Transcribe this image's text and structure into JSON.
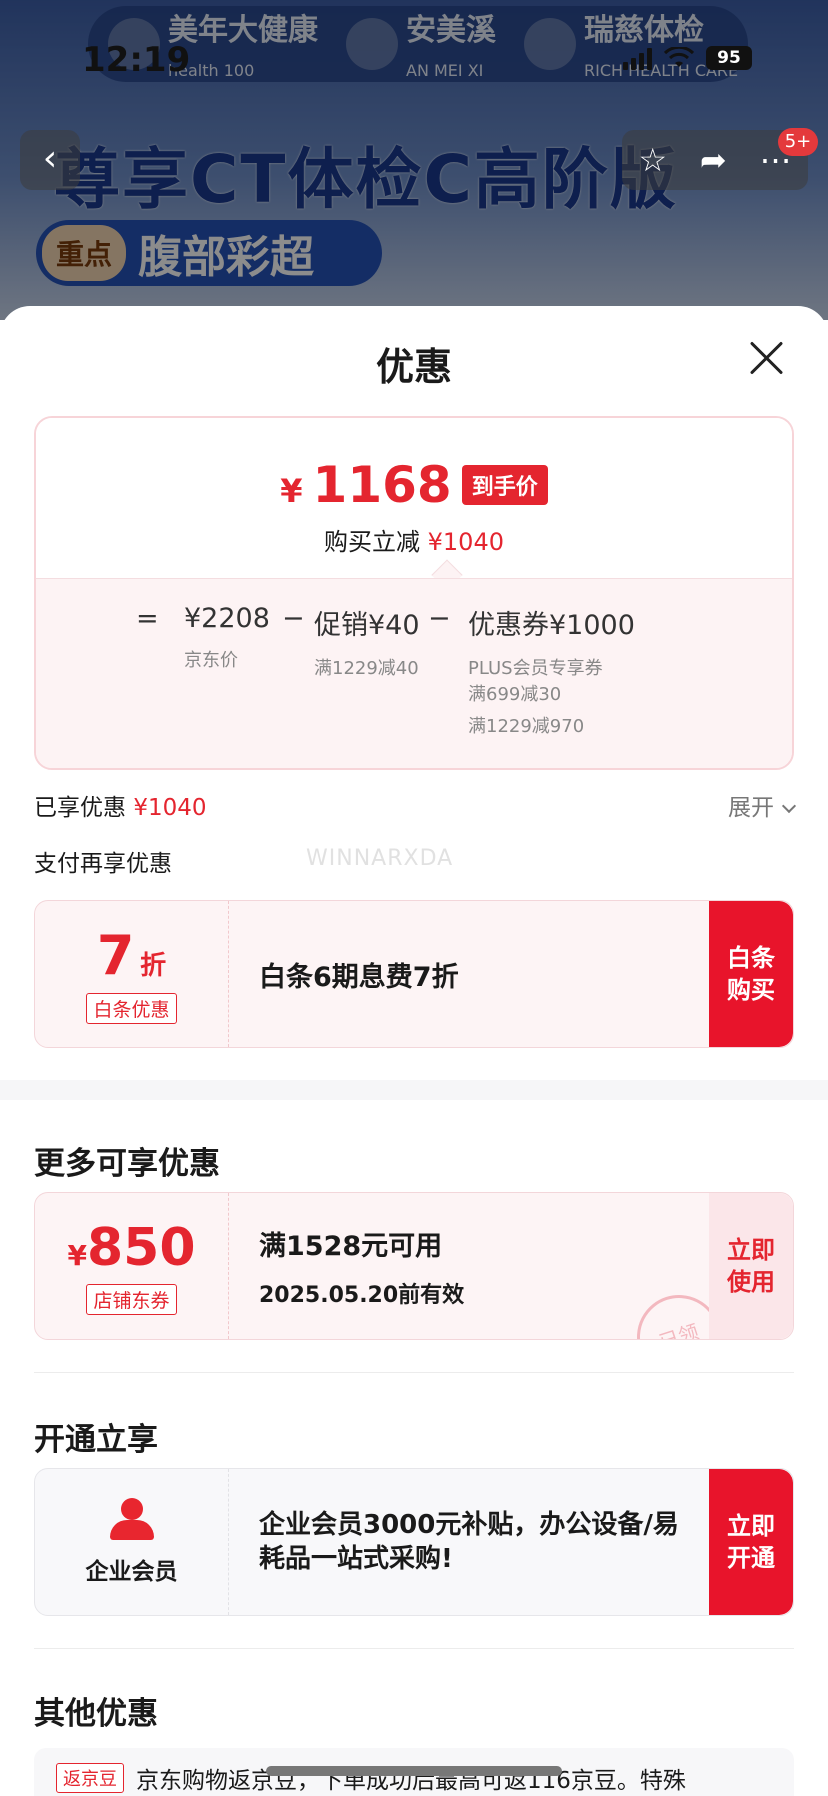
{
  "status_bar": {
    "time": "12:19",
    "battery": "95"
  },
  "background": {
    "brands": [
      {
        "name": "美年大健康",
        "sub": "health 100"
      },
      {
        "name": "安美溪",
        "sub": "AN MEI XI"
      },
      {
        "name": "瑞慈体检",
        "sub": "RICH HEALTH CARE"
      }
    ],
    "title": "尊享CT体检C高阶版",
    "pill_tag": "重点",
    "pill_text": "腹部彩超",
    "cart_badge": "5+"
  },
  "sheet": {
    "title": "优惠",
    "final_price": {
      "yen": "¥",
      "amount": "1168",
      "tag": "到手价"
    },
    "instant_reduce": {
      "label": "购买立减",
      "amount": "¥1040"
    },
    "breakdown": {
      "eq": "=",
      "minus": "−",
      "jd_price": {
        "value": "¥2208",
        "label": "京东价"
      },
      "promo": {
        "value": "促销¥40",
        "label": "满1229减40"
      },
      "coupon": {
        "value": "优惠券¥1000",
        "label1": "PLUS会员专享券",
        "label2": "满699减30",
        "label3": "满1229减970"
      }
    },
    "enjoyed": {
      "label": "已享优惠",
      "amount": "¥1040",
      "expand": "展开"
    },
    "pay_more_title": "支付再享优惠",
    "watermark": "WINNARXDA",
    "baitiao": {
      "num": "7",
      "unit": "折",
      "tag": "白条优惠",
      "desc": "白条6期息费7折",
      "cta": "白条购买"
    },
    "more_title": "更多可享优惠",
    "shop_coupon": {
      "yen": "¥",
      "amount": "850",
      "tag": "店铺东券",
      "line1": "满1528元可用",
      "line2": "2025.05.20前有效",
      "stamp": "已领",
      "cta": "立即使用"
    },
    "open_title": "开通立享",
    "enterprise": {
      "label": "企业会员",
      "desc": "企业会员3000元补贴，办公设备/易耗品一站式采购!",
      "cta": "立即开通"
    },
    "other_title": "其他优惠",
    "jingdou": {
      "tag": "返京豆",
      "text": "京东购物返京豆，下单成功后最高可返116京豆。特殊"
    }
  }
}
